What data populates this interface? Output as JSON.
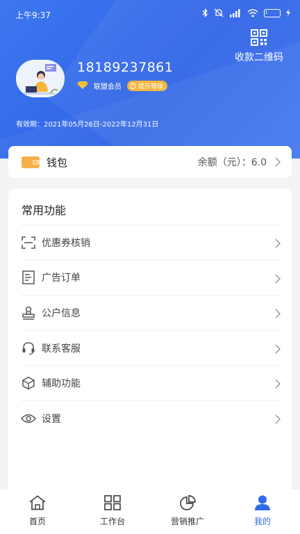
{
  "status_bar": {
    "time": "上午9:37",
    "battery": "1"
  },
  "header": {
    "qr_label": "收款二维码",
    "phone": "18189237861",
    "member_level": "联盟会员",
    "upgrade_label": "提升等级",
    "validity": "有效期：2021年05月26日-2022年12月31日"
  },
  "wallet": {
    "label": "钱包",
    "balance": "余额（元）：6.0"
  },
  "common": {
    "title": "常用功能",
    "items": [
      {
        "label": "优惠券核销",
        "icon": "scan-icon"
      },
      {
        "label": "广告订单",
        "icon": "document-icon"
      },
      {
        "label": "公户信息",
        "icon": "stamp-icon"
      },
      {
        "label": "联系客服",
        "icon": "headset-icon"
      },
      {
        "label": "辅助功能",
        "icon": "cube-icon"
      },
      {
        "label": "设置",
        "icon": "eye-icon"
      }
    ]
  },
  "tabs": [
    {
      "label": "首页",
      "icon": "home-icon"
    },
    {
      "label": "工作台",
      "icon": "grid-icon"
    },
    {
      "label": "营销推广",
      "icon": "pie-chart-icon"
    },
    {
      "label": "我的",
      "icon": "user-icon",
      "active": true
    }
  ],
  "colors": {
    "accent": "#2f6be9",
    "header": "#3d78f0",
    "badge": "#f5b63d"
  }
}
